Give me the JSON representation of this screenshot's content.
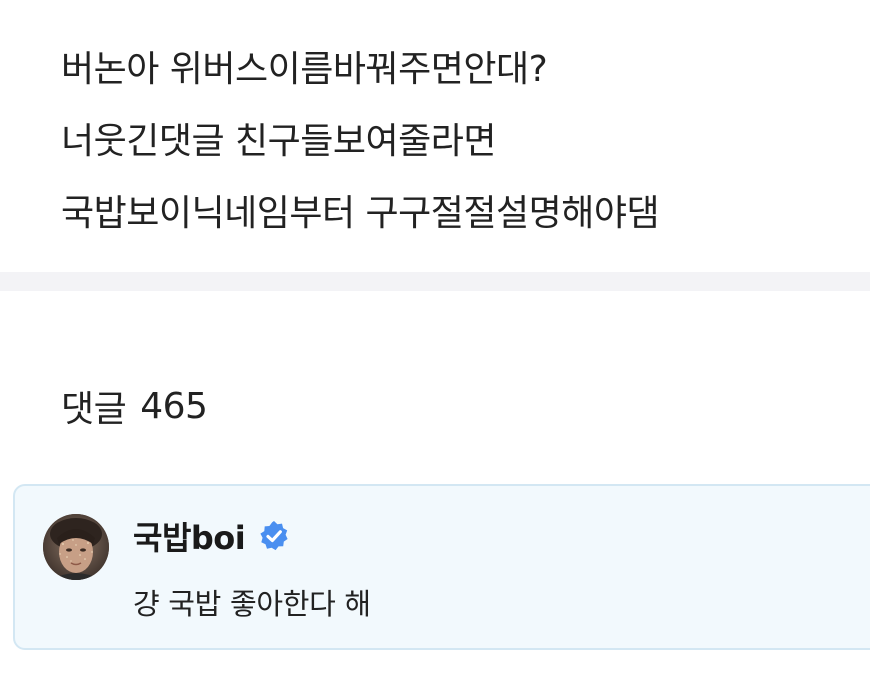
{
  "post": {
    "lines": [
      "버논아 위버스이름바꿔주면안대?",
      "너웃긴댓글 친구들보여줄라면",
      "국밥보이닉네임부터 구구절절설명해야댐"
    ]
  },
  "comments": {
    "label": "댓글",
    "count": "465"
  },
  "comment": {
    "author": "국밥boi",
    "verified": true,
    "text": "걍 국밥 좋아한다 해"
  },
  "colors": {
    "accent_verified": "#4a8ff0",
    "comment_background": "#f2f9fd",
    "comment_border": "#d3e7f3",
    "divider": "#f3f3f6"
  },
  "icons": {
    "verified": "verified-badge-icon",
    "avatar": "profile-photo"
  }
}
